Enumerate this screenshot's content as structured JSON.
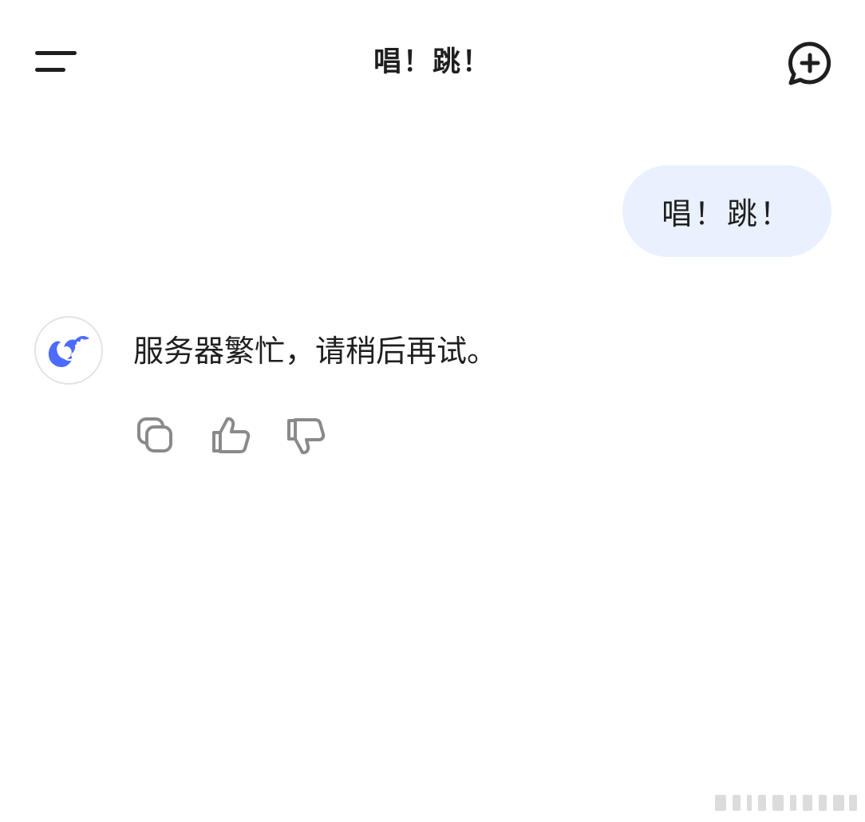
{
  "header": {
    "title": "唱！跳！",
    "menu_icon": "hamburger-menu-icon",
    "new_chat_icon": "new-chat-plus-bubble-icon"
  },
  "conversation": {
    "user_message": "唱！跳！",
    "assistant_avatar_icon": "deepseek-whale-logo-icon",
    "assistant_message": "服务器繁忙，请稍后再试。",
    "actions": [
      {
        "name": "copy",
        "icon": "copy-icon"
      },
      {
        "name": "like",
        "icon": "thumbs-up-icon"
      },
      {
        "name": "dislike",
        "icon": "thumbs-down-icon"
      }
    ]
  },
  "colors": {
    "background": "#ffffff",
    "text": "#1f1f1f",
    "user_bubble": "#e9f1fe",
    "brand_blue": "#4d6bfe",
    "action_icon": "#8a8a8a",
    "avatar_border": "#e3e3e3"
  }
}
